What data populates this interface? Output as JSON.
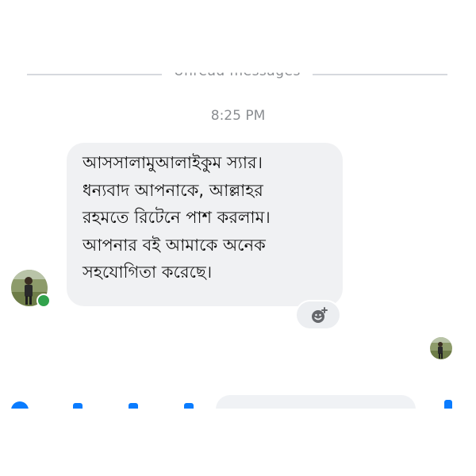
{
  "divider": {
    "label": "Unread messages"
  },
  "thread": {
    "timestamp": "8:25 PM",
    "message": {
      "lines": [
        "আসসালামুআলাইকুম স্যার।",
        "ধন্যবাদ আপনাকে, আল্লাহর",
        "রহমতে রিটেনে পাশ করলাম।",
        "আপনার বই আমাকে অনেক",
        "সহযোগিতা করেছে।"
      ]
    },
    "sender": {
      "status": "online"
    }
  },
  "icons": {
    "react": "smiley-add-icon",
    "online": "online-status-dot",
    "seen": "seen-avatar"
  },
  "colors": {
    "bubble": "#f0f1f3",
    "online": "#31a24c",
    "accent": "#0a7cff",
    "meta_text": "#8a8d91"
  }
}
